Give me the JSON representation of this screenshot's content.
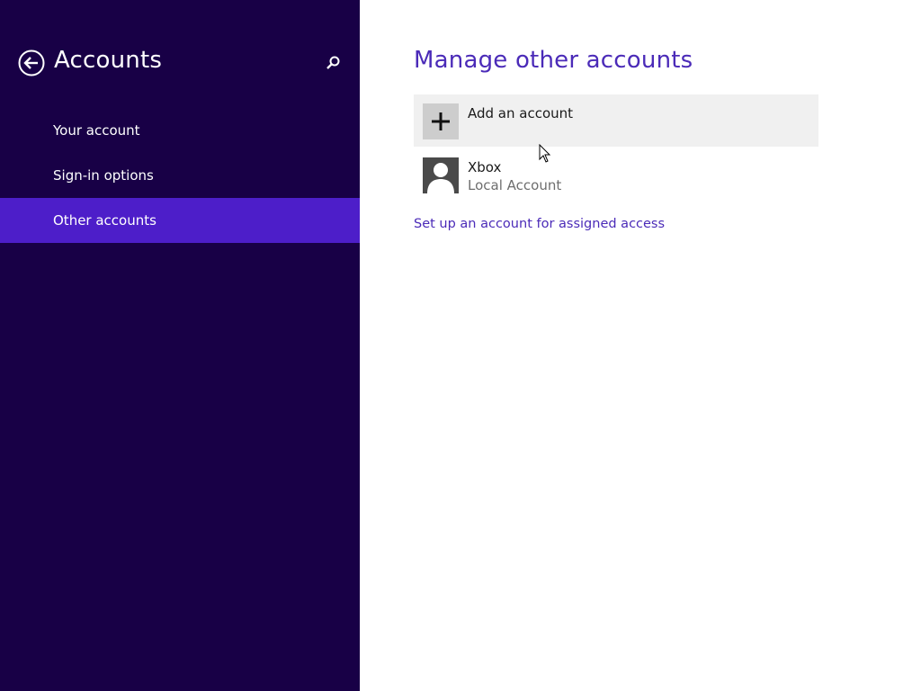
{
  "sidebar": {
    "title": "Accounts",
    "back_icon": "back-arrow-icon",
    "search_icon": "search-icon",
    "items": [
      {
        "label": "Your account",
        "active": false
      },
      {
        "label": "Sign-in options",
        "active": false
      },
      {
        "label": "Other accounts",
        "active": true
      }
    ]
  },
  "main": {
    "title": "Manage other accounts",
    "add_account_label": "Add an account",
    "accounts": [
      {
        "name": "Xbox",
        "type": "Local Account"
      }
    ],
    "assigned_access_link": "Set up an account for assigned access"
  },
  "colors": {
    "sidebar_bg": "#180046",
    "active_item_bg": "#4d1ec9",
    "accent": "#4b2bb8"
  }
}
